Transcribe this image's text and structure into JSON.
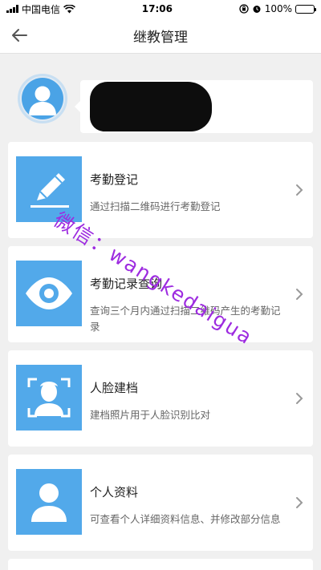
{
  "status_bar": {
    "carrier": "中国电信",
    "time": "17:06",
    "battery": "100%"
  },
  "nav": {
    "title": "继教管理"
  },
  "menu": [
    {
      "title": "考勤登记",
      "desc": "通过扫描二维码进行考勤登记",
      "icon": "pencil-icon"
    },
    {
      "title": "考勤记录查询",
      "desc": "查询三个月内通过扫描二维码产生的考勤记录",
      "icon": "eye-icon"
    },
    {
      "title": "人脸建档",
      "desc": "建档照片用于人脸识别比对",
      "icon": "face-scan-icon"
    },
    {
      "title": "个人资料",
      "desc": "可查看个人详细资料信息、并修改部分信息",
      "icon": "person-icon"
    }
  ],
  "watermark": "微信：wangkedaigua",
  "colors": {
    "tile": "#52a9ea",
    "watermark": "#9d2be0"
  }
}
